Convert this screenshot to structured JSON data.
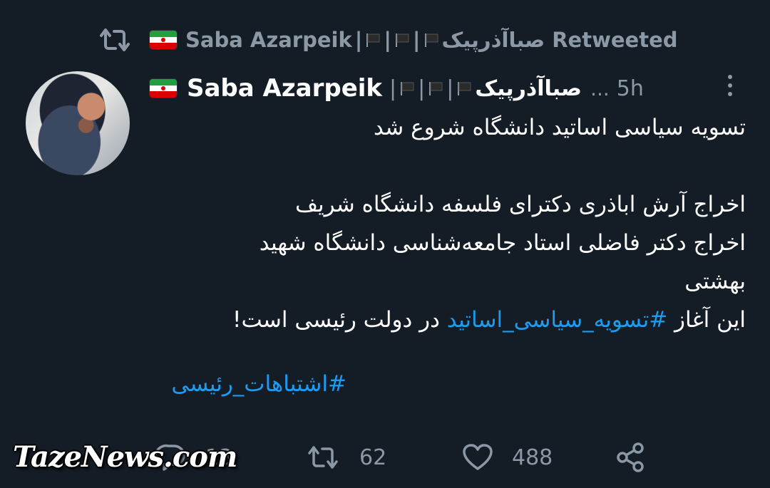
{
  "retweet_header": {
    "name": "Saba Azarpeik",
    "fa_name": "صباآذرپیک",
    "separator": "|",
    "label": "Retweeted"
  },
  "tweet": {
    "display_name": "Saba Azarpeik",
    "fa_name": "صباآذرپیک",
    "separator": "|",
    "dots": "...",
    "timestamp": "5h",
    "body": {
      "line1": "تسویه سیاسی اساتید دانشگاه شروع شد",
      "line2": "اخراج آرش اباذری دکترای فلسفه دانشگاه شریف",
      "line3": "اخراج دکتر فاضلی استاد جامعه‌شناسی دانشگاه شهید",
      "line4": "بهشتی",
      "line5_prefix": "این آغاز ",
      "line5_hashtag": "#تسویه_سیاسی_اساتید",
      "line5_suffix": " در دولت رئیسی است!",
      "hashtag2": "#اشتباهات_رئیسی"
    }
  },
  "actions": {
    "replies": "13",
    "retweets": "62",
    "likes": "488"
  },
  "watermark": "TazeNews.com",
  "icons": [
    "retweet-icon",
    "iran-flag-icon",
    "black-flag-icon",
    "more-icon",
    "reply-icon",
    "heart-icon",
    "share-icon"
  ],
  "colors": {
    "background": "#141d26",
    "text": "#ffffff",
    "muted": "#8b98a5",
    "link": "#1d9bf0"
  }
}
